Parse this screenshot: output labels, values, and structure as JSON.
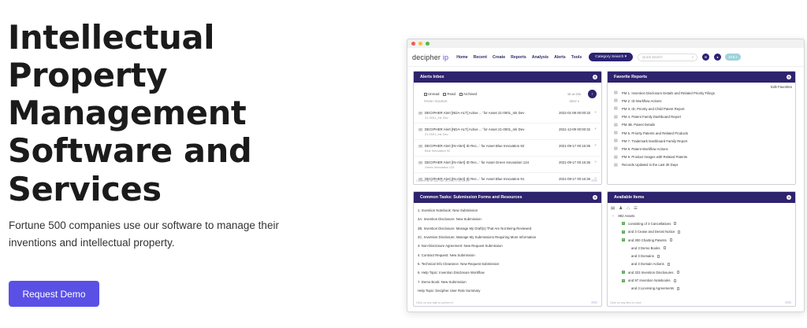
{
  "hero": {
    "title": "Intellectual Property Management Software and Services",
    "subtitle": "Fortune 500 companies use our software to manage their inventions and intellectual property.",
    "cta_label": "Request Demo",
    "cta_color": "#5b50e6"
  },
  "app": {
    "logo_main": "decipher",
    "logo_ip": "ip",
    "nav": [
      "Home",
      "Recent",
      "Create",
      "Reports",
      "Analysis",
      "Alerts",
      "Tools"
    ],
    "category_search": "Category Search",
    "quick_search_placeholder": "Quick Search",
    "version_badge": "19.8.1",
    "accent": "#2e236d"
  },
  "alerts_inbox": {
    "title": "Alerts Inbox",
    "tabs": [
      "Unread",
      "Read",
      "Archived"
    ],
    "count_text": "50 of 230",
    "from_label": "FROM / SOURCE",
    "sent_label": "SENT ▾",
    "items": [
      {
        "title": "DECIPHER Alert [NDA-ALT] Active ...' for Asset 21-0001_Ink Dev",
        "source": "21-0001_Ink Dev",
        "date": "2022-01-08 00:00:33"
      },
      {
        "title": "DECIPHER Alert [NDA-ALT] Active ...' for Asset 21-0001_Ink Dev",
        "source": "21-0001_Ink Dev",
        "date": "2021-12-09 00:00:32"
      },
      {
        "title": "DECIPHER Alert [IN-Alert] ID Rec...' for Asset Blue Innovation 92",
        "source": "Blue Innovation 92",
        "date": "2021-09-17 00:16:36"
      },
      {
        "title": "DECIPHER Alert [IN-Alert] ID Rec...' for Asset Green Innovation 124",
        "source": "Green Innovation 124",
        "date": "2021-09-17 00:16:36"
      },
      {
        "title": "DECIPHER Alert [IN-Alert] ID Rec...' for Asset Blue Innovation 91",
        "source": "",
        "date": "2021-09-17 00:16:36"
      }
    ],
    "footer": "Current as of Sun Jan 16 2022 2:33:40 pm"
  },
  "favorite_reports": {
    "title": "Favorite Reports",
    "edit_label": "Edit Favorites",
    "items": [
      "PM 1. Invention Disclosure Details and Related Priority Filings",
      "PM 2. ID Workflow Actions",
      "PM 3. ID, Priority and Child Patent Report",
      "PM 4. Patent Family Dashboard Report",
      "PM 4B. Patent Details",
      "PM 5. Priority Patents and Related Products",
      "PM 7. Trademark Dashboard Family Report",
      "PM 8. Patent Workflow Actions",
      "PM 9. Product Images with Related Patents",
      "Records Updated in the Last 30 Days"
    ]
  },
  "common_tasks": {
    "title": "Common Tasks: Submission Forms and Resources",
    "items": [
      "1. Invention Notebook: New Submission",
      "2A. Invention Disclosure: New Submission",
      "2B. Invention Disclosure: Manage My Draft(s) That Are Not Being Reviewed",
      "2C. Invention Disclosure: Manage My Submissions Requiring More Information",
      "3. Non-Disclosure Agreement: New Request Submission",
      "4. Contract Request: New Submission",
      "5. Technical Info Clearance: New Request Submission",
      "6. Help Topic: Invention Disclosure Workflow",
      "7. Demo Book: New Submission",
      "Help Topic: Decipher User Role Summary"
    ],
    "footer": "Click on any task to perform it"
  },
  "available_items": {
    "title": "Available Items",
    "root": "892 Assets",
    "items": [
      {
        "label": "consisting of 3 Cancellations",
        "expandable": true
      },
      {
        "label": "and 3 Cease and Desist Notice",
        "expandable": true
      },
      {
        "label": "and 300 Charting Patents",
        "expandable": true
      },
      {
        "label": "and 3 Demo Books",
        "expandable": false
      },
      {
        "label": "and 3 Domains",
        "expandable": false
      },
      {
        "label": "and 3 Domain Actions",
        "expandable": false
      },
      {
        "label": "and 323 Invention Disclosures",
        "expandable": true
      },
      {
        "label": "and 97 Invention Notebooks",
        "expandable": true
      },
      {
        "label": "and 3 Licensing Agreements",
        "expandable": false
      }
    ],
    "footer": "Click on any item to view"
  }
}
